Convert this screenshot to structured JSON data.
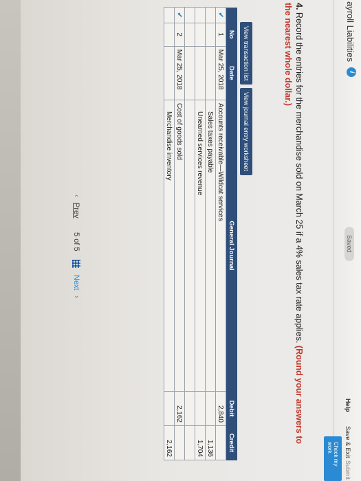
{
  "header": {
    "title": "ayroll Liabilities",
    "info_icon_glyph": "i",
    "saved": "Saved",
    "help": "Help",
    "save_exit": "Save & Exit",
    "submit": "Submit",
    "check_work": "Check my work"
  },
  "question": {
    "number": "4.",
    "text": "Record the entries for the merchandise sold on March 25 if a 4% sales tax rate applies.",
    "instruction": "(Round your answers to the nearest whole dollar.)"
  },
  "tabs": [
    {
      "label": "View transaction list"
    },
    {
      "label": "View journal entry worksheet"
    }
  ],
  "journal": {
    "headers": {
      "no": "No",
      "date": "Date",
      "account": "General Journal",
      "debit": "Debit",
      "credit": "Credit"
    },
    "rows": [
      {
        "check": "✔",
        "no": "1",
        "date": "Mar 25, 2018",
        "account": "Accounts receivable—Wildcat services",
        "debit": "2,840",
        "credit": ""
      },
      {
        "check": "",
        "no": "",
        "date": "",
        "account": "Sales taxes payable",
        "debit": "",
        "credit": "1,136"
      },
      {
        "check": "",
        "no": "",
        "date": "",
        "account": "Unearned services revenue",
        "debit": "",
        "credit": "1,704"
      },
      {
        "check": "",
        "no": "",
        "date": "",
        "account": "",
        "debit": "",
        "credit": ""
      },
      {
        "check": "✔",
        "no": "2",
        "date": "Mar 25, 2018",
        "account": "Cost of goods sold",
        "debit": "2,162",
        "credit": ""
      },
      {
        "check": "",
        "no": "",
        "date": "",
        "account": "Merchandise inventory",
        "debit": "",
        "credit": "2,162"
      }
    ]
  },
  "pager": {
    "prev": "Prev",
    "page_current": "5",
    "page_of": "of",
    "page_total": "5",
    "next": "Next"
  },
  "colors": {
    "accent": "#2a8ad4",
    "header": "#2f4f7a",
    "alert": "#c0392b"
  }
}
